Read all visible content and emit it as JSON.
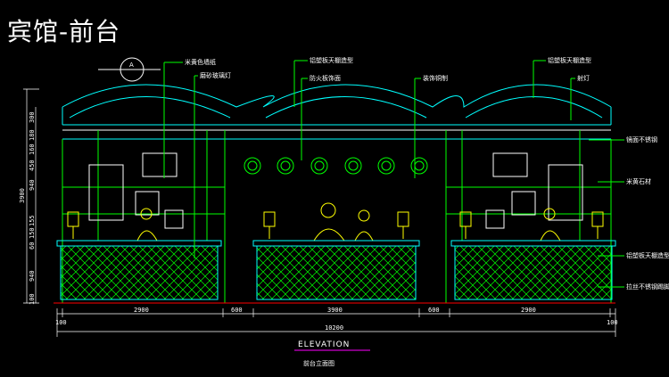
{
  "title": "宾馆-前台",
  "section_marker": "A",
  "callouts_top": [
    "米黄色墙纸",
    "磨砂玻璃灯",
    "铝塑板天棚造型",
    "防火板饰面",
    "装饰铜制",
    "铝塑板天棚造型",
    "射灯"
  ],
  "callouts_top_b": [
    "铝塑板天棚造型"
  ],
  "callouts_right": [
    "镜面不锈钢",
    "米黄石材",
    "铝塑板天棚造型",
    "拉丝不锈钢踢脚"
  ],
  "dims_bottom": [
    "100",
    "2900",
    "600",
    "3900",
    "600",
    "2900",
    "100"
  ],
  "dim_total": "10200",
  "dims_left": [
    "300",
    "180",
    "160",
    "450",
    "940",
    "155",
    "150",
    "60",
    "940",
    "100"
  ],
  "dim_left_total": "3900",
  "elevation_label": "ELEVATION",
  "elevation_sub": "前台立面图",
  "colors": {
    "line": "#00ffff",
    "green": "#00ff00",
    "yellow": "#ffff00",
    "white": "#ffffff",
    "red": "#ff0000",
    "magenta": "#ff00ff"
  }
}
